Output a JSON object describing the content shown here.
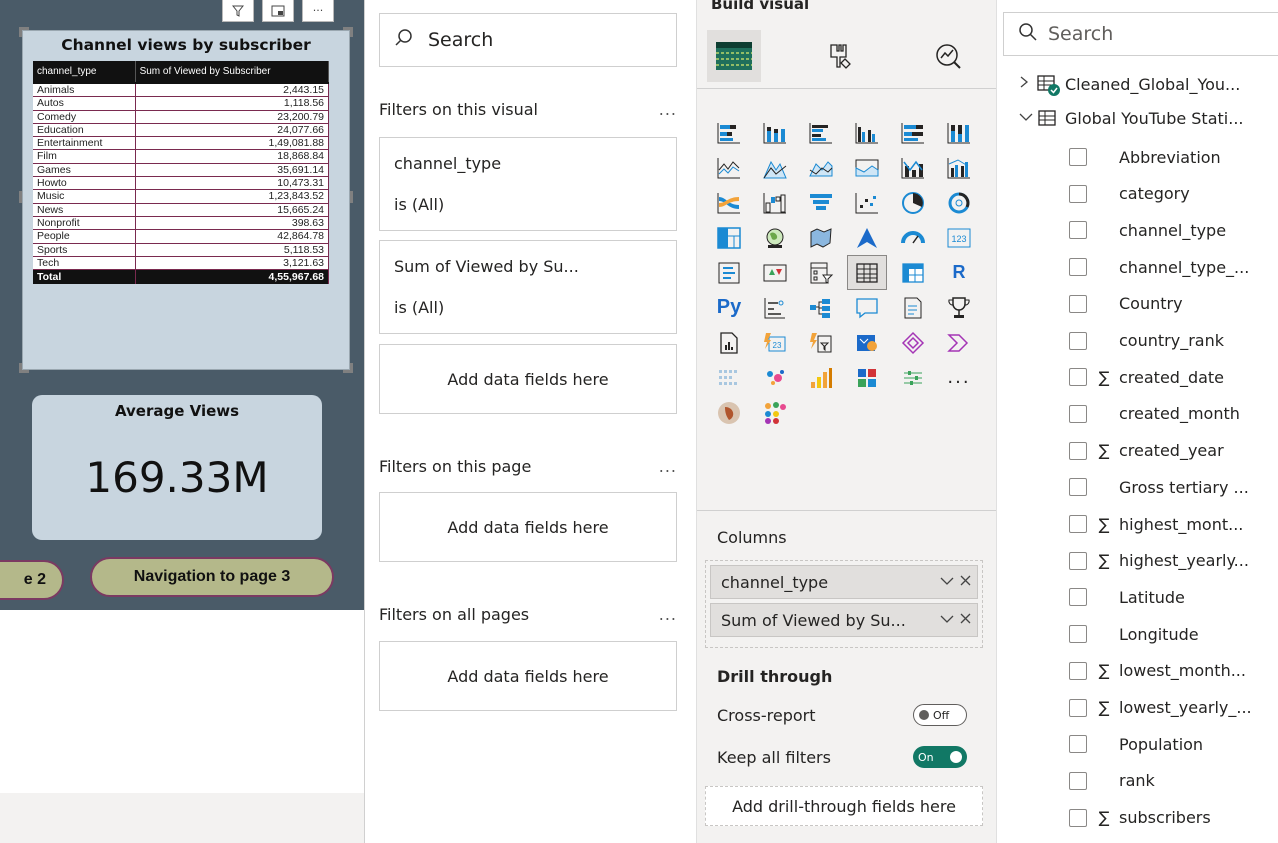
{
  "canvas": {
    "table_visual": {
      "title": "Channel views by subscriber",
      "columns": [
        "channel_type",
        "Sum of Viewed by Subscriber"
      ],
      "rows": [
        [
          "Animals",
          "2,443.15"
        ],
        [
          "Autos",
          "1,118.56"
        ],
        [
          "Comedy",
          "23,200.79"
        ],
        [
          "Education",
          "24,077.66"
        ],
        [
          "Entertainment",
          "1,49,081.88"
        ],
        [
          "Film",
          "18,868.84"
        ],
        [
          "Games",
          "35,691.14"
        ],
        [
          "Howto",
          "10,473.31"
        ],
        [
          "Music",
          "1,23,843.52"
        ],
        [
          "News",
          "15,665.24"
        ],
        [
          "Nonprofit",
          "398.63"
        ],
        [
          "People",
          "42,864.78"
        ],
        [
          "Sports",
          "5,118.53"
        ],
        [
          "Tech",
          "3,121.63"
        ]
      ],
      "total": [
        "Total",
        "4,55,967.68"
      ]
    },
    "card": {
      "label": "Average Views",
      "value": "169.33M"
    },
    "nav_buttons": {
      "page2": "e 2",
      "page3": "Navigation to page 3"
    }
  },
  "filters": {
    "search_placeholder": "Search",
    "on_visual_heading": "Filters on this visual",
    "on_page_heading": "Filters on this page",
    "on_all_heading": "Filters on all pages",
    "more": "...",
    "cards": [
      {
        "field": "channel_type",
        "state": "is (All)"
      },
      {
        "field": "Sum of Viewed by Su...",
        "state": "is (All)"
      }
    ],
    "add_fields": "Add data fields here"
  },
  "visualizations": {
    "header": "Build visual",
    "more": "...",
    "columns_label": "Columns",
    "column_fields": [
      "channel_type",
      "Sum of Viewed by Su..."
    ],
    "drill_through_label": "Drill through",
    "cross_report_label": "Cross-report",
    "cross_report_state": "Off",
    "keep_filters_label": "Keep all filters",
    "keep_filters_state": "On",
    "drill_add": "Add drill-through fields here",
    "r_label": "R",
    "py_label": "Py",
    "num_123": "123",
    "num_23": "23"
  },
  "data": {
    "search_placeholder": "Search",
    "tables": [
      {
        "name": "Cleaned_Global_You...",
        "expanded": false
      },
      {
        "name": "Global YouTube Stati...",
        "expanded": true
      }
    ],
    "fields": [
      {
        "name": "Abbreviation",
        "sigma": false
      },
      {
        "name": "category",
        "sigma": false
      },
      {
        "name": "channel_type",
        "sigma": false
      },
      {
        "name": "channel_type_...",
        "sigma": false
      },
      {
        "name": "Country",
        "sigma": false
      },
      {
        "name": "country_rank",
        "sigma": false
      },
      {
        "name": "created_date",
        "sigma": true
      },
      {
        "name": "created_month",
        "sigma": false
      },
      {
        "name": "created_year",
        "sigma": true
      },
      {
        "name": "Gross tertiary ...",
        "sigma": false
      },
      {
        "name": "highest_mont...",
        "sigma": true
      },
      {
        "name": "highest_yearly...",
        "sigma": true
      },
      {
        "name": "Latitude",
        "sigma": false
      },
      {
        "name": "Longitude",
        "sigma": false
      },
      {
        "name": "lowest_month...",
        "sigma": true
      },
      {
        "name": "lowest_yearly_...",
        "sigma": true
      },
      {
        "name": "Population",
        "sigma": false
      },
      {
        "name": "rank",
        "sigma": false
      },
      {
        "name": "subscribers",
        "sigma": true
      }
    ],
    "sigma_symbol": "∑"
  }
}
